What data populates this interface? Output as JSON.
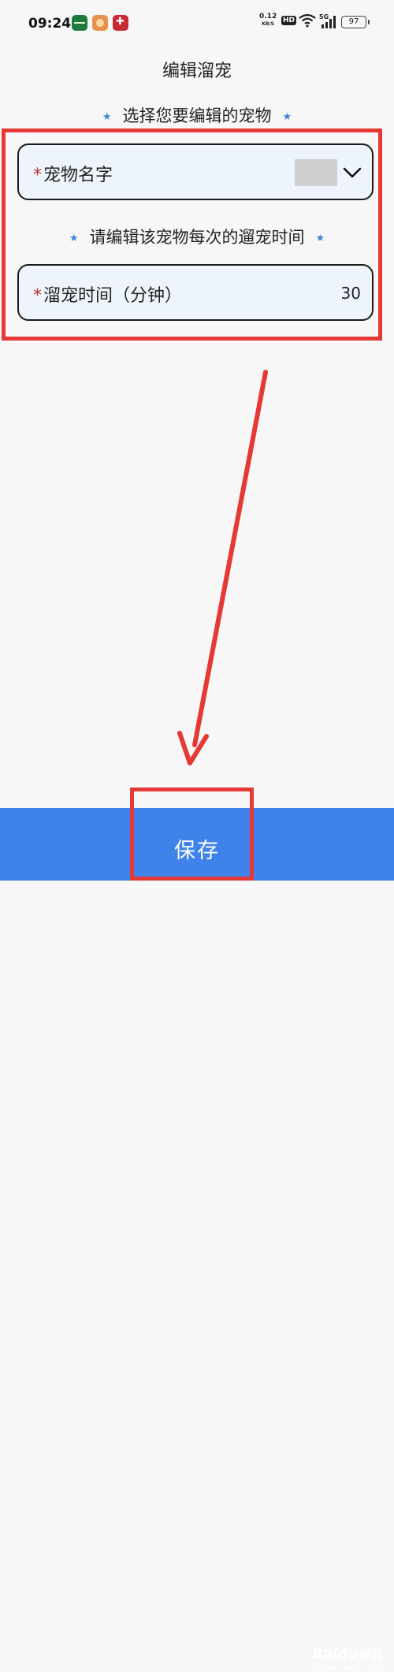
{
  "status_bar": {
    "time": "09:24",
    "net_speed_value": "0.12",
    "net_speed_unit": "KB/S",
    "hd_badge": "HD",
    "signal_type": "5G",
    "battery": "97"
  },
  "page": {
    "title": "编辑溜宠"
  },
  "pet_section": {
    "heading": "选择您要编辑的宠物",
    "required_mark": "*",
    "field_label": "宠物名字"
  },
  "time_section": {
    "heading": "请编辑该宠物每次的遛宠时间",
    "required_mark": "*",
    "field_label": "溜宠时间（分钟）",
    "value": "30"
  },
  "save_button": {
    "label": "保存"
  },
  "watermark": {
    "logo": "Baidu",
    "brand": "经验",
    "url": "jingyan.baidu.com"
  },
  "colors": {
    "accent_blue": "#3f83ea",
    "annotation_red": "#e53935",
    "required_red": "#b5323a",
    "star_blue": "#3c84d7"
  }
}
